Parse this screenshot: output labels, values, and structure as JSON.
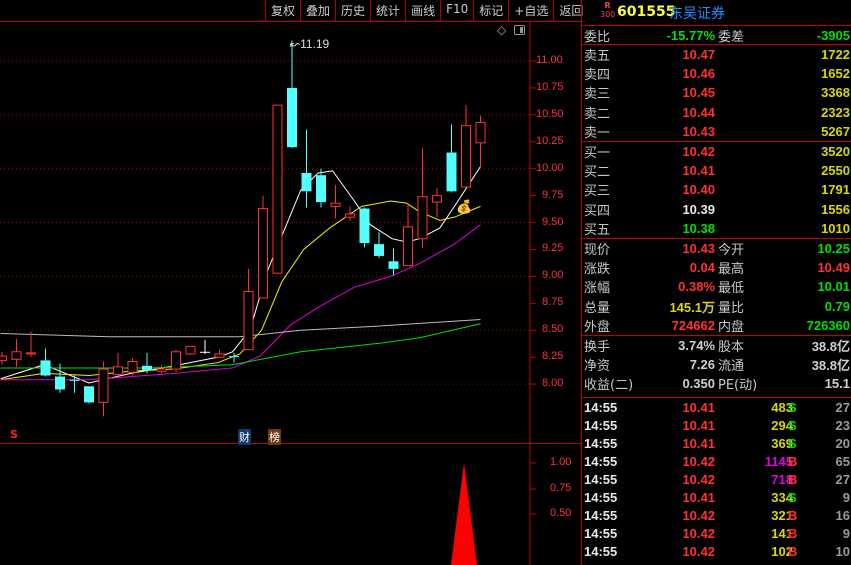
{
  "toolbar": [
    "复权",
    "叠加",
    "历史",
    "统计",
    "画线",
    "F10",
    "标记",
    "+自选",
    "返回"
  ],
  "stock": {
    "badge_top": "R",
    "badge_bottom": "300",
    "code": "601555",
    "name": "东吴证券"
  },
  "chart_data": {
    "type": "candlestick",
    "price_axis": {
      "ticks": [
        "11.00",
        "10.75",
        "10.50",
        "10.25",
        "10.00",
        "9.75",
        "9.50",
        "9.25",
        "9.00",
        "8.75",
        "8.50",
        "8.25",
        "8.00"
      ],
      "range": [
        7.6,
        11.3
      ]
    },
    "peak_label": "11.19",
    "candles": [
      [
        8.22,
        8.26,
        8.3,
        8.18
      ],
      [
        8.23,
        8.3,
        8.42,
        8.16
      ],
      [
        8.28,
        8.29,
        8.49,
        8.25
      ],
      [
        8.22,
        8.08,
        8.33,
        8.07
      ],
      [
        8.07,
        7.95,
        8.19,
        7.92
      ],
      [
        8.04,
        8.03,
        8.08,
        7.92
      ],
      [
        7.98,
        7.83,
        7.98,
        7.82
      ],
      [
        7.83,
        8.14,
        8.21,
        7.7
      ],
      [
        8.09,
        8.16,
        8.29,
        8.07
      ],
      [
        8.11,
        8.21,
        8.24,
        8.08
      ],
      [
        8.17,
        8.13,
        8.29,
        8.1
      ],
      [
        8.12,
        8.14,
        8.18,
        8.1
      ],
      [
        8.14,
        8.3,
        8.32,
        8.11
      ],
      [
        8.28,
        8.35,
        8.35,
        8.27
      ],
      [
        8.3,
        8.3,
        8.41,
        8.28
      ],
      [
        8.25,
        8.28,
        8.32,
        8.25
      ],
      [
        8.26,
        8.26,
        8.29,
        8.2
      ],
      [
        8.32,
        8.86,
        9.07,
        8.32
      ],
      [
        8.8,
        9.63,
        9.75,
        8.8
      ],
      [
        9.03,
        10.59,
        10.59,
        9.03
      ],
      [
        10.75,
        10.2,
        11.19,
        10.19
      ],
      [
        9.96,
        9.79,
        10.36,
        9.64
      ],
      [
        9.94,
        9.69,
        10.0,
        9.64
      ],
      [
        9.65,
        9.68,
        9.85,
        9.54
      ],
      [
        9.55,
        9.58,
        9.65,
        9.52
      ],
      [
        9.63,
        9.31,
        9.64,
        9.27
      ],
      [
        9.3,
        9.19,
        9.41,
        9.17
      ],
      [
        9.14,
        9.07,
        9.26,
        9.01
      ],
      [
        9.1,
        9.46,
        9.68,
        9.1
      ],
      [
        9.35,
        9.74,
        10.19,
        9.26
      ],
      [
        9.69,
        9.75,
        9.82,
        9.55
      ],
      [
        10.15,
        9.79,
        10.41,
        9.78
      ],
      [
        9.83,
        10.4,
        10.59,
        9.83
      ],
      [
        10.24,
        10.43,
        10.49,
        10.01
      ]
    ],
    "ma": [
      {
        "name": "MA5",
        "color": "#ffffff",
        "points": [
          [
            -0.1,
            8.05
          ],
          [
            2.9,
            8.18
          ],
          [
            6,
            8.01
          ],
          [
            8.9,
            8.1
          ],
          [
            11.9,
            8.17
          ],
          [
            14.9,
            8.25
          ],
          [
            15.9,
            8.3
          ],
          [
            17.1,
            8.5
          ],
          [
            18.3,
            9.05
          ],
          [
            20.6,
            9.8
          ],
          [
            21.8,
            9.96
          ],
          [
            22.8,
            9.98
          ],
          [
            24.3,
            9.7
          ],
          [
            25.4,
            9.48
          ],
          [
            26.9,
            9.35
          ],
          [
            27.9,
            9.32
          ],
          [
            28.8,
            9.35
          ],
          [
            30.2,
            9.45
          ],
          [
            31.2,
            9.65
          ],
          [
            33,
            10.02
          ]
        ]
      },
      {
        "name": "MA10",
        "color": "#f0f000",
        "points": [
          [
            -0.1,
            8.04
          ],
          [
            2.9,
            8.1
          ],
          [
            6,
            8.08
          ],
          [
            8.9,
            8.12
          ],
          [
            11.9,
            8.14
          ],
          [
            14.9,
            8.2
          ],
          [
            16.4,
            8.28
          ],
          [
            17.9,
            8.5
          ],
          [
            19.3,
            8.95
          ],
          [
            20.8,
            9.25
          ],
          [
            22.6,
            9.45
          ],
          [
            24.8,
            9.65
          ],
          [
            26.8,
            9.7
          ],
          [
            27.9,
            9.68
          ],
          [
            28.8,
            9.6
          ],
          [
            30.2,
            9.52
          ],
          [
            31.2,
            9.55
          ],
          [
            33,
            9.65
          ]
        ]
      },
      {
        "name": "MA20",
        "color": "#e000e0",
        "points": [
          [
            -0.1,
            8.04
          ],
          [
            6,
            8.04
          ],
          [
            11.9,
            8.1
          ],
          [
            15.9,
            8.15
          ],
          [
            17.8,
            8.26
          ],
          [
            19.9,
            8.55
          ],
          [
            21.9,
            8.72
          ],
          [
            24.3,
            8.9
          ],
          [
            26.8,
            9.0
          ],
          [
            28.8,
            9.12
          ],
          [
            31.2,
            9.3
          ],
          [
            33,
            9.48
          ]
        ]
      },
      {
        "name": "MA60",
        "color": "#00e000",
        "points": [
          [
            -0.1,
            8.15
          ],
          [
            10.2,
            8.15
          ],
          [
            15.9,
            8.18
          ],
          [
            20.6,
            8.3
          ],
          [
            26.1,
            8.38
          ],
          [
            28.8,
            8.43
          ],
          [
            33,
            8.56
          ]
        ]
      },
      {
        "name": "MA120",
        "color": "#bbbbbb",
        "points": [
          [
            -0.1,
            8.47
          ],
          [
            7.4,
            8.44
          ],
          [
            16.4,
            8.44
          ],
          [
            20.6,
            8.5
          ],
          [
            26.1,
            8.54
          ],
          [
            33,
            8.6
          ]
        ]
      }
    ],
    "markers": {
      "s": "S",
      "cai": "财",
      "bang": "榜"
    },
    "indicator": {
      "ticks": [
        "1.00",
        "0.75",
        "0.50"
      ],
      "signal_index": 32,
      "signal_value": 1.0
    }
  },
  "quote": {
    "weibi": {
      "label": "委比",
      "value": "-15.77%",
      "label2": "委差",
      "value2": "-3905"
    },
    "sell": [
      {
        "label": "卖五",
        "price": "10.47",
        "vol": "1722"
      },
      {
        "label": "卖四",
        "price": "10.46",
        "vol": "1652"
      },
      {
        "label": "卖三",
        "price": "10.45",
        "vol": "3368"
      },
      {
        "label": "卖二",
        "price": "10.44",
        "vol": "2323"
      },
      {
        "label": "卖一",
        "price": "10.43",
        "vol": "5267"
      }
    ],
    "buy": [
      {
        "label": "买一",
        "price": "10.42",
        "vol": "3520",
        "c": "r"
      },
      {
        "label": "买二",
        "price": "10.41",
        "vol": "2550",
        "c": "r"
      },
      {
        "label": "买三",
        "price": "10.40",
        "vol": "1791",
        "c": "r"
      },
      {
        "label": "买四",
        "price": "10.39",
        "vol": "1556",
        "c": "w"
      },
      {
        "label": "买五",
        "price": "10.38",
        "vol": "1010",
        "c": "g"
      }
    ],
    "stats": [
      {
        "l1": "现价",
        "v1": "10.43",
        "c1": "r",
        "l2": "今开",
        "v2": "10.25",
        "c2": "g"
      },
      {
        "l1": "涨跌",
        "v1": "0.04",
        "c1": "r",
        "l2": "最高",
        "v2": "10.49",
        "c2": "r"
      },
      {
        "l1": "涨幅",
        "v1": "0.38%",
        "c1": "r",
        "l2": "最低",
        "v2": "10.01",
        "c2": "g"
      },
      {
        "l1": "总量",
        "v1": "145.1万",
        "c1": "y",
        "l2": "量比",
        "v2": "0.79",
        "c2": "g"
      },
      {
        "l1": "外盘",
        "v1": "724662",
        "c1": "r",
        "l2": "内盘",
        "v2": "726360",
        "c2": "g"
      }
    ],
    "fin": [
      {
        "l1": "换手",
        "v1": "3.74%",
        "l2": "股本",
        "v2": "38.8亿"
      },
      {
        "l1": "净资",
        "v1": "7.26",
        "l2": "流通",
        "v2": "38.8亿"
      },
      {
        "l1": "收益(二)",
        "v1": "0.350",
        "l2": "PE(动)",
        "v2": "15.1"
      }
    ]
  },
  "ticks": [
    {
      "t": "14:55",
      "p": "10.41",
      "v": "483",
      "vc": "y",
      "d": "S",
      "n": "27"
    },
    {
      "t": "14:55",
      "p": "10.41",
      "v": "294",
      "vc": "y",
      "d": "S",
      "n": "23"
    },
    {
      "t": "14:55",
      "p": "10.41",
      "v": "369",
      "vc": "y",
      "d": "S",
      "n": "20"
    },
    {
      "t": "14:55",
      "p": "10.42",
      "v": "1145",
      "vc": "m",
      "d": "B",
      "n": "65"
    },
    {
      "t": "14:55",
      "p": "10.42",
      "v": "718",
      "vc": "m",
      "d": "B",
      "n": "27"
    },
    {
      "t": "14:55",
      "p": "10.41",
      "v": "334",
      "vc": "y",
      "d": "S",
      "n": "9"
    },
    {
      "t": "14:55",
      "p": "10.42",
      "v": "321",
      "vc": "y",
      "d": "B",
      "n": "16"
    },
    {
      "t": "14:55",
      "p": "10.42",
      "v": "141",
      "vc": "y",
      "d": "B",
      "n": "9"
    },
    {
      "t": "14:55",
      "p": "10.42",
      "v": "102",
      "vc": "y",
      "d": "B",
      "n": "10"
    }
  ]
}
